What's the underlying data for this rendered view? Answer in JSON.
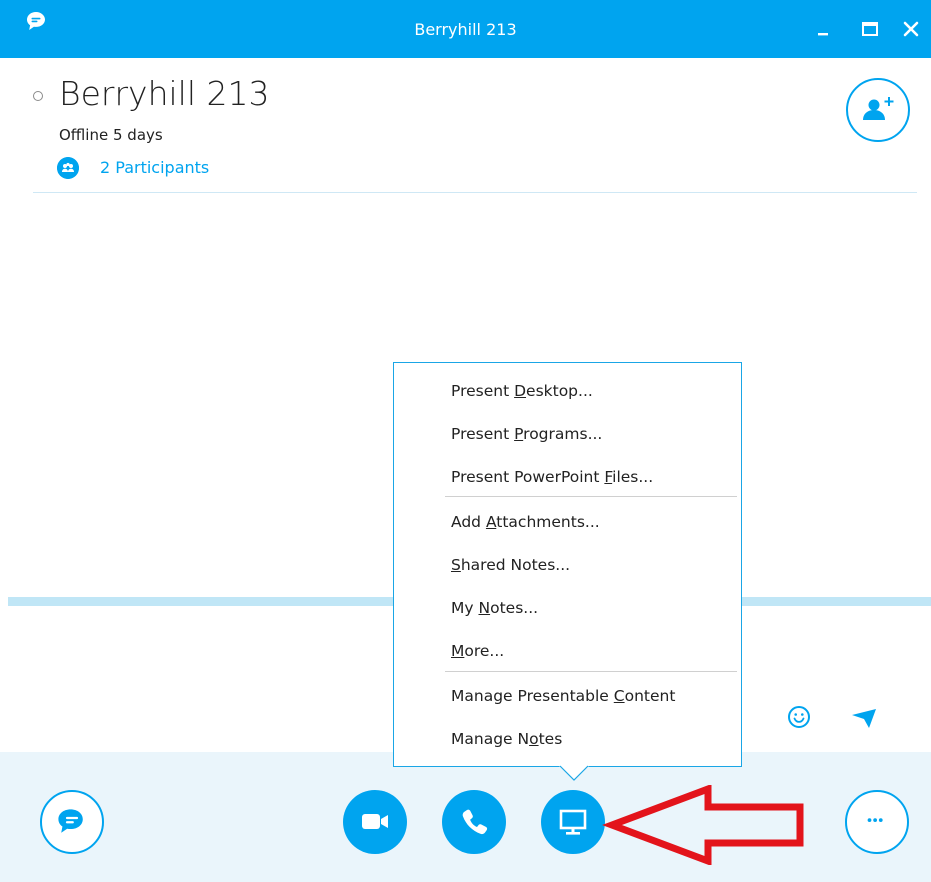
{
  "window": {
    "title": "Berryhill 213"
  },
  "contact": {
    "name": "Berryhill 213",
    "status": "Offline 5 days",
    "participants_label": "2 Participants"
  },
  "menu": {
    "items": [
      {
        "pre": "Present ",
        "key": "D",
        "post": "esktop..."
      },
      {
        "pre": "Present ",
        "key": "P",
        "post": "rograms..."
      },
      {
        "pre": "Present PowerPoint ",
        "key": "F",
        "post": "iles..."
      },
      {
        "pre": "Add ",
        "key": "A",
        "post": "ttachments..."
      },
      {
        "pre": "",
        "key": "S",
        "post": "hared Notes..."
      },
      {
        "pre": "My ",
        "key": "N",
        "post": "otes..."
      },
      {
        "pre": "",
        "key": "M",
        "post": "ore..."
      },
      {
        "pre": "Manage Presentable ",
        "key": "C",
        "post": "ontent"
      },
      {
        "pre": "Manage N",
        "key": "o",
        "post": "tes"
      }
    ]
  },
  "icons": {
    "app_logo": "skype-chat-icon",
    "minimize": "minimize-icon",
    "maximize": "maximize-icon",
    "close": "close-icon",
    "add_people": "add-people-icon",
    "emoji": "emoticon-icon",
    "send": "send-icon",
    "chat": "chat-icon",
    "video": "video-camera-icon",
    "call": "phone-icon",
    "share": "share-screen-icon",
    "more": "more-options-icon"
  },
  "colors": {
    "accent": "#00a4ef",
    "bottom_bar": "#eaf5fb",
    "annotation_arrow": "#e3141b"
  }
}
